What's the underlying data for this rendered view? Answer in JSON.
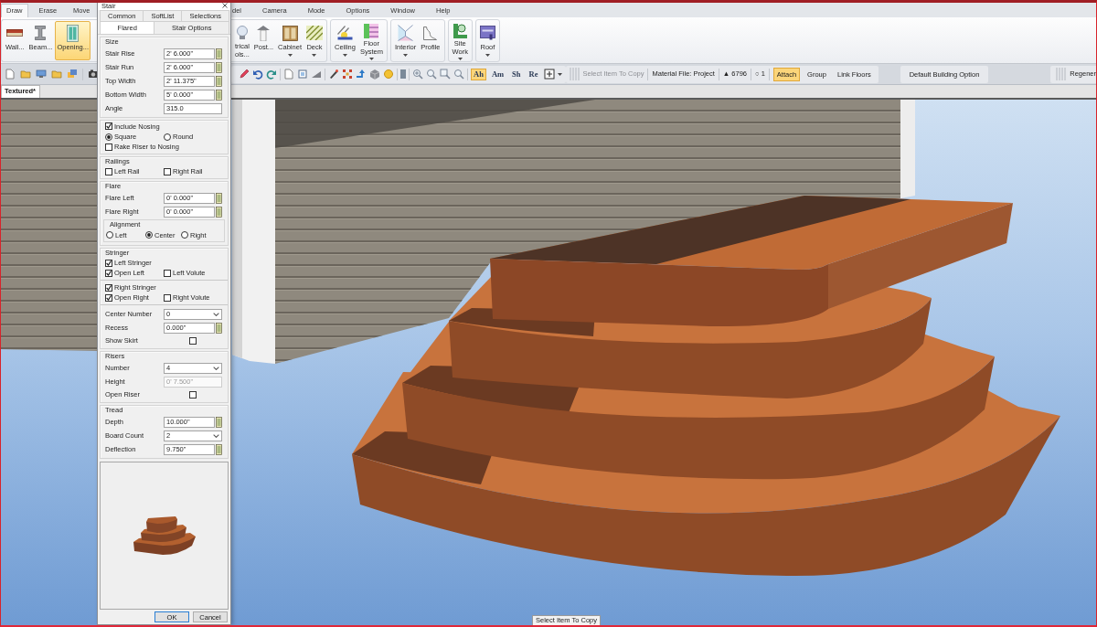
{
  "menu_bar": {
    "left": [
      {
        "label": "Draw",
        "selected": true
      },
      {
        "label": "Erase",
        "selected": false
      },
      {
        "label": "Move",
        "selected": false
      }
    ],
    "right": [
      {
        "label": "del",
        "selected": false
      },
      {
        "label": "Camera",
        "selected": false
      },
      {
        "label": "Mode",
        "selected": false
      },
      {
        "label": "Options",
        "selected": false
      },
      {
        "label": "Window",
        "selected": false
      },
      {
        "label": "Help",
        "selected": false
      }
    ]
  },
  "ribbon": {
    "left": [
      {
        "buttons": [
          {
            "label": "Wall...",
            "selected": false,
            "dropdown": false
          },
          {
            "label": "Beam...",
            "selected": false,
            "dropdown": false
          },
          {
            "label": "Opening...",
            "selected": true,
            "dropdown": false
          }
        ]
      }
    ],
    "right": [
      {
        "buttons": [
          {
            "label": "trical\nols...",
            "selected": false,
            "dropdown": false
          },
          {
            "label": "Post...",
            "selected": false,
            "dropdown": false
          },
          {
            "label": "Cabinet",
            "selected": false,
            "dropdown": true
          },
          {
            "label": "Deck",
            "selected": false,
            "dropdown": true
          }
        ]
      },
      {
        "buttons": [
          {
            "label": "Ceiling",
            "selected": false,
            "dropdown": true
          },
          {
            "label": "Floor\nSystem",
            "selected": false,
            "dropdown": true
          }
        ]
      },
      {
        "buttons": [
          {
            "label": "Interior",
            "selected": false,
            "dropdown": true
          },
          {
            "label": "Profile",
            "selected": false,
            "dropdown": false
          }
        ]
      },
      {
        "buttons": [
          {
            "label": "Site\nWork",
            "selected": false,
            "dropdown": true
          }
        ]
      },
      {
        "buttons": [
          {
            "label": "Roof",
            "selected": false,
            "dropdown": true
          }
        ]
      }
    ]
  },
  "toolbar": {
    "view_toggles": [
      {
        "label": "Ah",
        "on": true
      },
      {
        "label": "Am",
        "on": false
      },
      {
        "label": "Sh",
        "on": false
      },
      {
        "label": "Re",
        "on": false
      }
    ],
    "hint": "Select Item To Copy",
    "material_file": "Material File: Project",
    "counters": [
      "▲ 6796",
      "○ 1"
    ],
    "modes": [
      {
        "label": "Attach",
        "on": true
      },
      {
        "label": "Group",
        "on": false
      },
      {
        "label": "Link Floors",
        "on": false
      }
    ],
    "building_option": "Default Building Option",
    "cut_button": "Regener"
  },
  "document_tabs": [
    {
      "label": "Textured*",
      "selected": true
    }
  ],
  "dialog": {
    "title": "Stair",
    "tabs": [
      [
        {
          "label": "Common",
          "selected": false
        },
        {
          "label": "SoftList",
          "selected": false
        },
        {
          "label": "Selections",
          "selected": false
        }
      ],
      [
        {
          "label": "Flared",
          "selected": true
        },
        {
          "label": "Stair Options",
          "selected": false
        }
      ]
    ],
    "groups": [
      {
        "title": "Size",
        "rows": [
          {
            "kind": "calc",
            "label": "Stair Rise",
            "value": "2' 6.000\""
          },
          {
            "kind": "calc",
            "label": "Stair Run",
            "value": "2' 6.000\""
          },
          {
            "kind": "calc",
            "label": "Top Width",
            "value": "2' 11.375\""
          },
          {
            "kind": "calc",
            "label": "Bottom Width",
            "value": "5' 0.000\""
          },
          {
            "kind": "text",
            "label": "Angle",
            "value": "315.0",
            "disabled": false
          }
        ]
      },
      {
        "header_check": {
          "label": "Include Nosing",
          "checked": true
        },
        "rows": [
          {
            "kind": "radios",
            "options": [
              {
                "label": "Square",
                "selected": true
              },
              {
                "label": "Round",
                "selected": false
              }
            ]
          },
          {
            "kind": "checks",
            "options": [
              {
                "label": "Rake Riser to Nosing",
                "checked": false
              }
            ]
          }
        ]
      },
      {
        "title": "Railings",
        "rows": [
          {
            "kind": "checks",
            "options": [
              {
                "label": "Left Rail",
                "checked": false
              },
              {
                "label": "Right Rail",
                "checked": false
              }
            ]
          }
        ]
      },
      {
        "title": "Flare",
        "rows": [
          {
            "kind": "calc",
            "label": "Flare Left",
            "value": "0' 0.000\""
          },
          {
            "kind": "calc",
            "label": "Flare Right",
            "value": "0' 0.000\""
          },
          {
            "kind": "radios",
            "title": "Alignment",
            "options": [
              {
                "label": "Left",
                "selected": false
              },
              {
                "label": "Center",
                "selected": true
              },
              {
                "label": "Right",
                "selected": false
              }
            ]
          }
        ]
      },
      {
        "title": "Stringer",
        "rows": [
          {
            "kind": "checks",
            "options": [
              {
                "label": "Left Stringer",
                "checked": true
              }
            ]
          },
          {
            "kind": "checks",
            "options": [
              {
                "label": "Open Left",
                "checked": true
              },
              {
                "label": "Left Volute",
                "checked": false
              }
            ]
          },
          {
            "kind": "separator"
          },
          {
            "kind": "checks",
            "options": [
              {
                "label": "Right Stringer",
                "checked": true
              }
            ]
          },
          {
            "kind": "checks",
            "options": [
              {
                "label": "Open Right",
                "checked": true
              },
              {
                "label": "Right Volute",
                "checked": false
              }
            ]
          },
          {
            "kind": "separator"
          },
          {
            "kind": "select",
            "label": "Center Number",
            "value": "0"
          },
          {
            "kind": "calc",
            "label": "Recess",
            "value": "0.000\""
          },
          {
            "kind": "toggle",
            "label": "Show Skirt",
            "checked": false
          }
        ]
      },
      {
        "title": "Risers",
        "rows": [
          {
            "kind": "select",
            "label": "Number",
            "value": "4"
          },
          {
            "kind": "text",
            "label": "Height",
            "value": "0' 7.500\"",
            "disabled": true
          },
          {
            "kind": "toggle",
            "label": "Open Riser",
            "checked": false
          }
        ]
      },
      {
        "title": "Tread",
        "rows": [
          {
            "kind": "calc",
            "label": "Depth",
            "value": "10.000\""
          },
          {
            "kind": "select",
            "label": "Board Count",
            "value": "2"
          },
          {
            "kind": "calc",
            "label": "Deflection",
            "value": "9.750\""
          }
        ]
      }
    ],
    "buttons": [
      "OK",
      "Cancel"
    ]
  },
  "status_tip": "Select Item To Copy"
}
